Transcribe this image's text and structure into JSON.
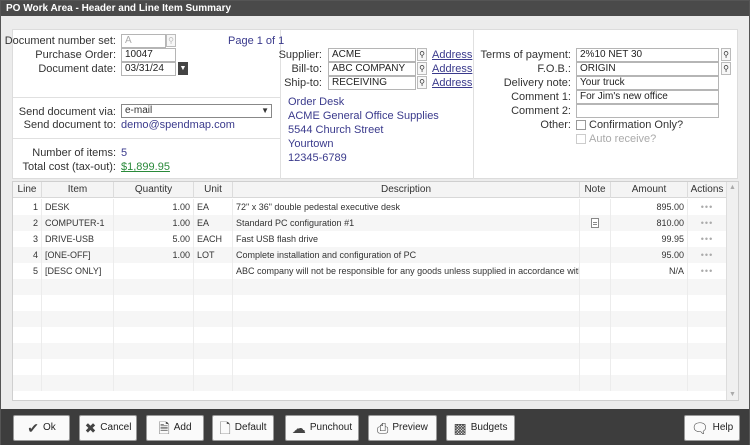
{
  "window": {
    "title": "PO Work Area - Header and Line Item Summary"
  },
  "header": {
    "doc_number_set": {
      "label": "Document number set:",
      "value": "A"
    },
    "purchase_order": {
      "label": "Purchase Order:",
      "value": "10047"
    },
    "document_date": {
      "label": "Document date:",
      "value": "03/31/24"
    },
    "page_indicator": "Page 1 of 1",
    "send_via": {
      "label": "Send document via:",
      "value": "e-mail"
    },
    "send_to": {
      "label": "Send document to:",
      "value": "demo@spendmap.com"
    },
    "num_items": {
      "label": "Number of items:",
      "value": "5"
    },
    "total_cost": {
      "label": "Total cost (tax-out):",
      "value": "$1,899.95"
    },
    "supplier": {
      "label": "Supplier:",
      "value": "ACME",
      "link": "Address"
    },
    "bill_to": {
      "label": "Bill-to:",
      "value": "ABC COMPANY",
      "link": "Address"
    },
    "ship_to": {
      "label": "Ship-to:",
      "value": "RECEIVING",
      "link": "Address"
    },
    "address_lines": [
      "Order Desk",
      "ACME General Office Supplies",
      "5544 Church Street",
      "Yourtown",
      "12345-6789"
    ],
    "terms": {
      "label": "Terms of payment:",
      "value": "2%10 NET 30"
    },
    "fob": {
      "label": "F.O.B.:",
      "value": "ORIGIN"
    },
    "delivery_note": {
      "label": "Delivery note:",
      "value": "Your truck"
    },
    "comment1": {
      "label": "Comment 1:",
      "value": "For Jim's new office"
    },
    "comment2": {
      "label": "Comment 2:",
      "value": ""
    },
    "other": {
      "label": "Other:"
    },
    "confirmation_only": "Confirmation Only?",
    "auto_receive": "Auto receive?"
  },
  "grid": {
    "columns": [
      "Line",
      "Item",
      "Quantity",
      "Unit",
      "Description",
      "Note",
      "Amount",
      "Actions"
    ],
    "rows": [
      {
        "line": "1",
        "item": "DESK",
        "qty": "1.00",
        "unit": "EA",
        "desc": "72\" x 36\" double pedestal executive desk",
        "note": false,
        "amount": "895.00"
      },
      {
        "line": "2",
        "item": "COMPUTER-1",
        "qty": "1.00",
        "unit": "EA",
        "desc": "Standard PC configuration #1",
        "note": true,
        "amount": "810.00"
      },
      {
        "line": "3",
        "item": "DRIVE-USB",
        "qty": "5.00",
        "unit": "EACH",
        "desc": "Fast USB flash drive",
        "note": false,
        "amount": "99.95"
      },
      {
        "line": "4",
        "item": "[ONE-OFF]",
        "qty": "1.00",
        "unit": "LOT",
        "desc": "Complete installation and configuration of PC",
        "note": false,
        "amount": "95.00"
      },
      {
        "line": "5",
        "item": "[DESC ONLY]",
        "qty": "",
        "unit": "",
        "desc": "ABC company will not be responsible for any goods unless supplied in accordance with an official P",
        "note": false,
        "amount": "N/A"
      }
    ],
    "actions_glyph": "•••"
  },
  "toolbar": {
    "ok": "Ok",
    "cancel": "Cancel",
    "add": "Add",
    "default": "Default",
    "punchout": "Punchout",
    "preview": "Preview",
    "budgets": "Budgets",
    "help": "Help"
  }
}
